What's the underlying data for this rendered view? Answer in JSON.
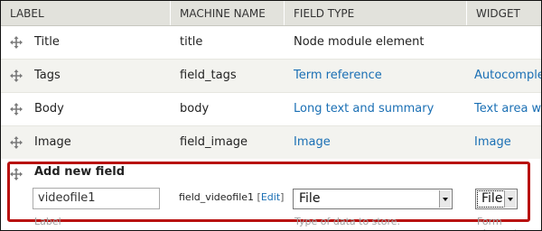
{
  "headers": {
    "label": "LABEL",
    "machine_name": "MACHINE NAME",
    "field_type": "FIELD TYPE",
    "widget": "WIDGET"
  },
  "rows": [
    {
      "label": "Title",
      "machine_name": "title",
      "field_type": "Node module element",
      "field_type_is_link": false,
      "widget": ""
    },
    {
      "label": "Tags",
      "machine_name": "field_tags",
      "field_type": "Term reference",
      "field_type_is_link": true,
      "widget": "Autocomplete"
    },
    {
      "label": "Body",
      "machine_name": "body",
      "field_type": "Long text and summary",
      "field_type_is_link": true,
      "widget": "Text area with"
    },
    {
      "label": "Image",
      "machine_name": "field_image",
      "field_type": "Image",
      "field_type_is_link": true,
      "widget": "Image"
    }
  ],
  "new_field": {
    "title": "Add new field",
    "label_value": "videofile1",
    "label_hint": "Label",
    "machine_name": "field_videofile1",
    "edit_link": "Edit",
    "field_type_selected": "File",
    "field_type_hint": "Type of data to store.",
    "widget_selected": "File",
    "widget_hint": "Form element"
  },
  "colors": {
    "link": "#1a6fb4",
    "highlight_box": "#b8110f",
    "header_bg": "#e2e2dc",
    "even_row_bg": "#f3f3ef"
  },
  "icons": {
    "drag_handle": "move-arrows-icon",
    "select_arrow": "chevron-down-icon"
  }
}
